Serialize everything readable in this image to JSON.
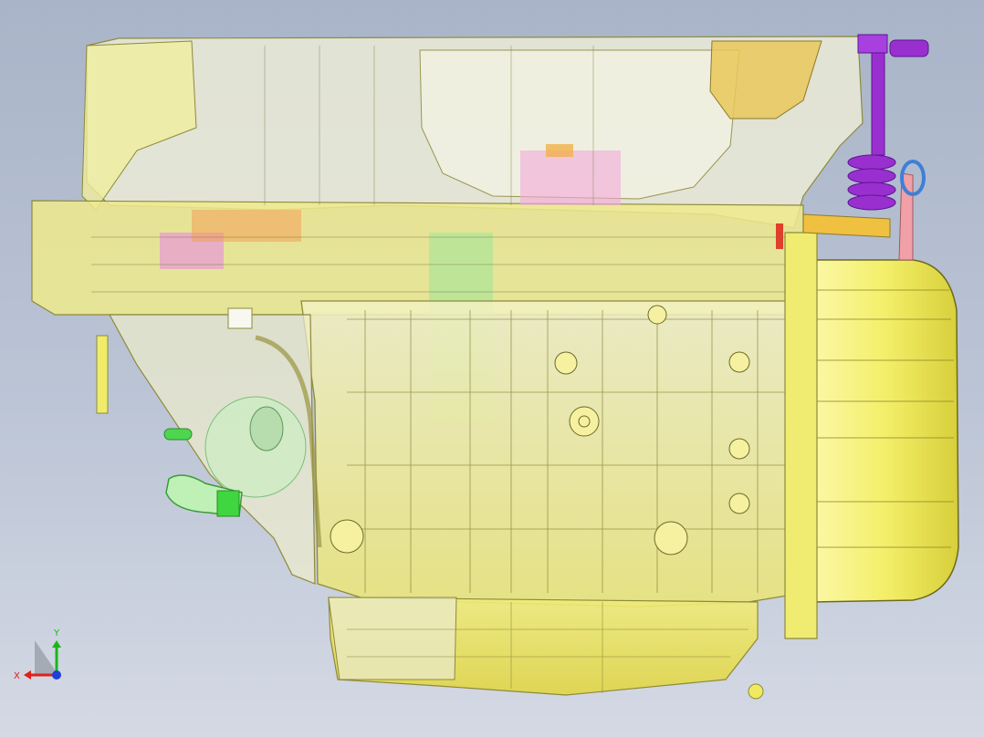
{
  "viewport": {
    "background_top": "#a9b4c8",
    "background_bottom": "#d4d9e4"
  },
  "model": {
    "component": "transparent-engine-assembly",
    "colors": {
      "housing": "#ecec8a",
      "housing_edge": "#8d8a3a",
      "bright_yellow": "#f3ef3c",
      "rear_cover": "#f6f27a",
      "purple_spring": "#9a2fd0",
      "green_bracket": "#4fd64f",
      "pink_pipe": "#f0a0a6",
      "blue_ring": "#3f7fd6",
      "orange_part": "#f2a05a",
      "magenta_part": "#e78be3"
    }
  },
  "triad": {
    "x_label": "X",
    "y_label": "Y",
    "x_color": "#e0201c",
    "y_color": "#18b818",
    "z_color": "#1e3fd8"
  }
}
